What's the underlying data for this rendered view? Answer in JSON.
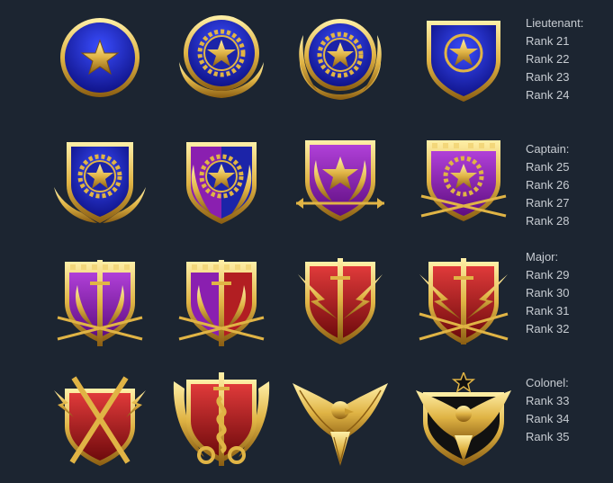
{
  "colors": {
    "background": "#1c2531",
    "text": "#c7ccd2",
    "gold": "#e9c45a",
    "gold_dark": "#9a6b1c",
    "blue": "#1c24a8",
    "purple": "#8a1fb0",
    "red": "#b21e22",
    "black": "#111111"
  },
  "rows": [
    {
      "title": "Lieutenant:",
      "ranks": [
        "Rank 21",
        "Rank 22",
        "Rank 23",
        "Rank 24"
      ],
      "badges": [
        {
          "icon": "blue-circle-star-icon"
        },
        {
          "icon": "blue-circle-gear-star-wings-icon"
        },
        {
          "icon": "blue-circle-gear-star-laurel-icon"
        },
        {
          "icon": "blue-shield-star-icon"
        }
      ]
    },
    {
      "title": "Captain:",
      "ranks": [
        "Rank 25",
        "Rank 26",
        "Rank 27",
        "Rank 28"
      ],
      "badges": [
        {
          "icon": "blue-shield-gear-star-wings-icon"
        },
        {
          "icon": "purple-blue-shield-gear-star-laurel-icon"
        },
        {
          "icon": "purple-shield-star-arrow-icon"
        },
        {
          "icon": "purple-castle-shield-star-arrows-icon"
        }
      ]
    },
    {
      "title": "Major:",
      "ranks": [
        "Rank 29",
        "Rank 30",
        "Rank 31",
        "Rank 32"
      ],
      "badges": [
        {
          "icon": "purple-castle-shield-sword-laurel-icon"
        },
        {
          "icon": "purple-red-castle-shield-sword-laurel-icon"
        },
        {
          "icon": "red-shield-sword-lightning-icon"
        },
        {
          "icon": "red-shield-sword-lightning-arrows-icon"
        }
      ]
    },
    {
      "title": "Colonel:",
      "ranks": [
        "Rank 33",
        "Rank 34",
        "Rank 35"
      ],
      "badges": [
        {
          "icon": "red-shield-crossed-swords-icon"
        },
        {
          "icon": "red-shield-snake-sword-wings-icon"
        },
        {
          "icon": "gold-eagle-icon"
        },
        {
          "icon": "black-shield-eagle-star-icon"
        }
      ]
    }
  ]
}
